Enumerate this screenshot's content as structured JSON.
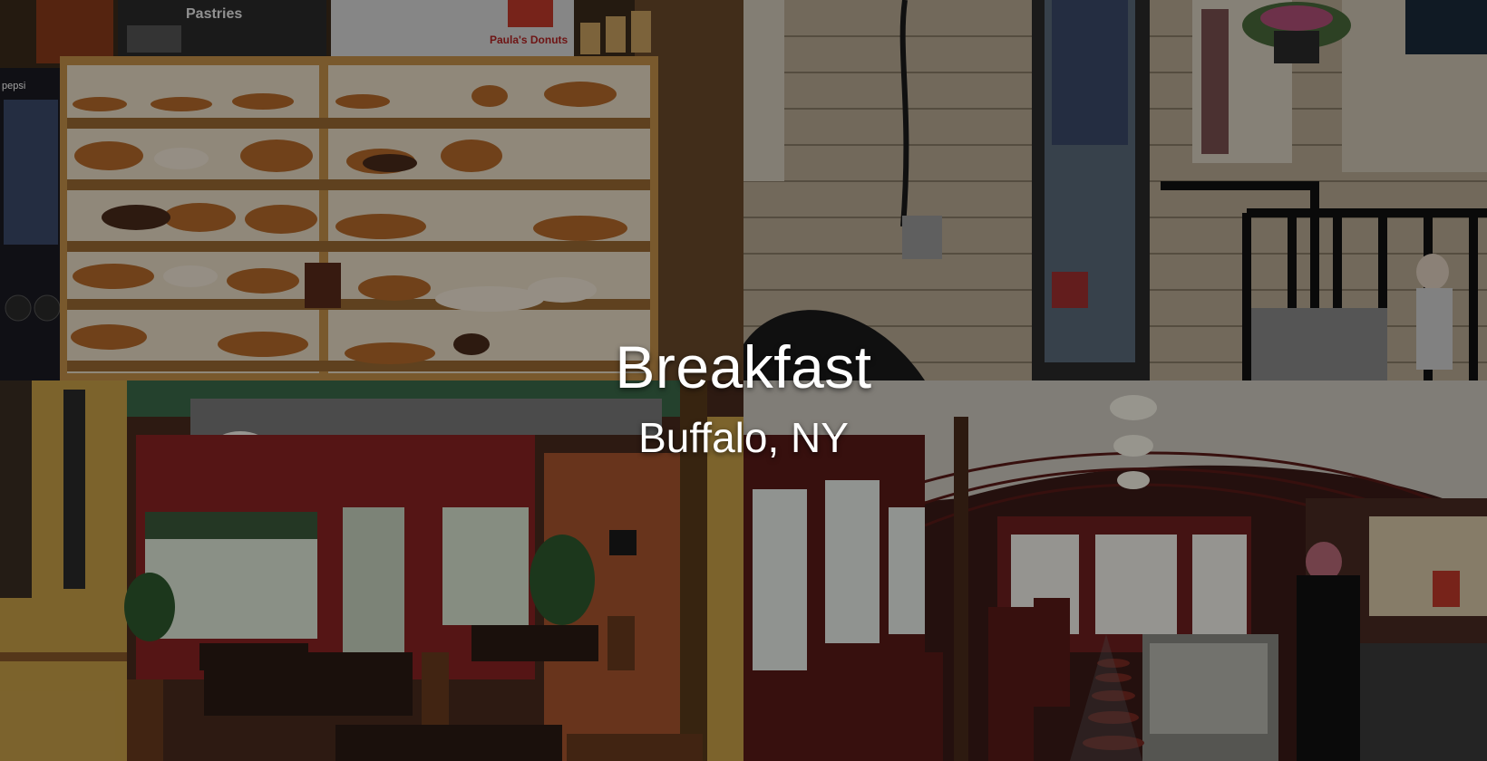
{
  "overlay": {
    "title": "Breakfast",
    "subtitle": "Buffalo, NY"
  },
  "panels": {
    "donut_shop": {
      "menu_heading": "Pastries",
      "brand_sign": "Paula's Donuts",
      "cooler_brand": "pepsi"
    }
  },
  "colors": {
    "overlay_text": "#ffffff",
    "shelf_wood": "#b07a3a",
    "diner_red": "#6e1f1f",
    "brick": "#8a4a2c"
  }
}
